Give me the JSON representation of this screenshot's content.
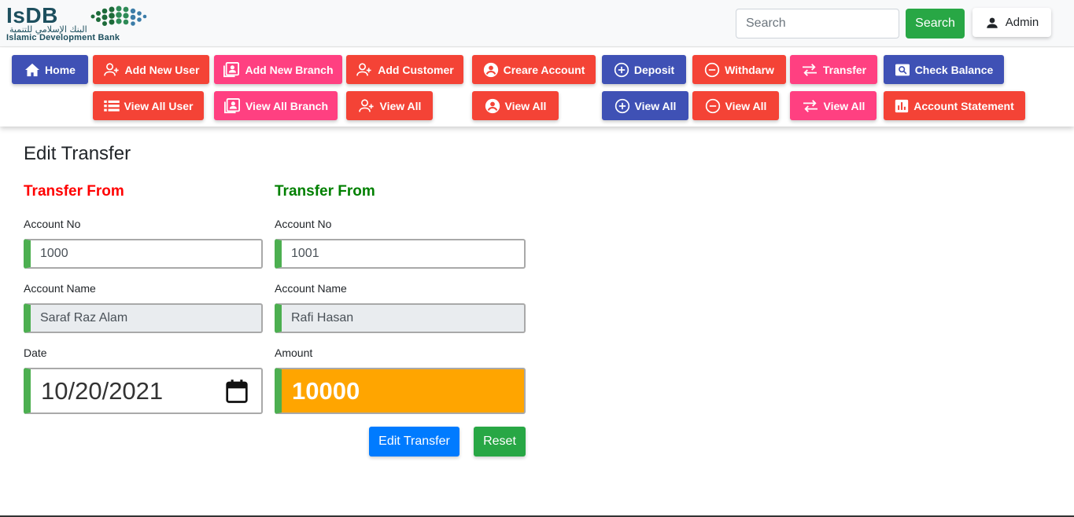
{
  "brand": {
    "logo_text": "IsDB",
    "logo_arabic": "البنك الإسلامي للتنمية",
    "logo_subtitle": "Islamic Development Bank"
  },
  "header": {
    "search_placeholder": "Search",
    "search_button": "Search",
    "admin_label": "Admin"
  },
  "nav": {
    "row1": {
      "home": "Home",
      "add_new_user": "Add New User",
      "add_new_branch": "Add New Branch",
      "add_customer": "Add Customer",
      "create_account": "Creare Account",
      "deposit": "Deposit",
      "withdraw": "Withdarw",
      "transfer": "Transfer",
      "check_balance": "Check Balance"
    },
    "row2": {
      "view_all_user": "View All User",
      "view_all_branch": "View All Branch",
      "view_all_customer": "View All",
      "view_all_account": "View All",
      "view_all_deposit": "View All",
      "view_all_withdraw": "View All",
      "view_all_transfer": "View All",
      "account_statement": "Account Statement"
    }
  },
  "page": {
    "title": "Edit Transfer",
    "from_title": "Transfer From",
    "to_title": "Transfer From",
    "from": {
      "account_no_label": "Account No",
      "account_no": "1000",
      "account_name_label": "Account Name",
      "account_name": "Saraf Raz Alam",
      "date_label": "Date",
      "date": "10/20/2021"
    },
    "to": {
      "account_no_label": "Account No",
      "account_no": "1001",
      "account_name_label": "Account Name",
      "account_name": "Rafi Hasan",
      "amount_label": "Amount",
      "amount": "10000"
    },
    "edit_button": "Edit Transfer",
    "reset_button": "Reset"
  },
  "colors": {
    "indigo": "#3f51b5",
    "red": "#f44336",
    "pink": "#ff4081",
    "green": "#28a745",
    "blue": "#007bff",
    "orange": "#ffa500",
    "from_title": "#ff0000",
    "to_title": "#008000"
  }
}
